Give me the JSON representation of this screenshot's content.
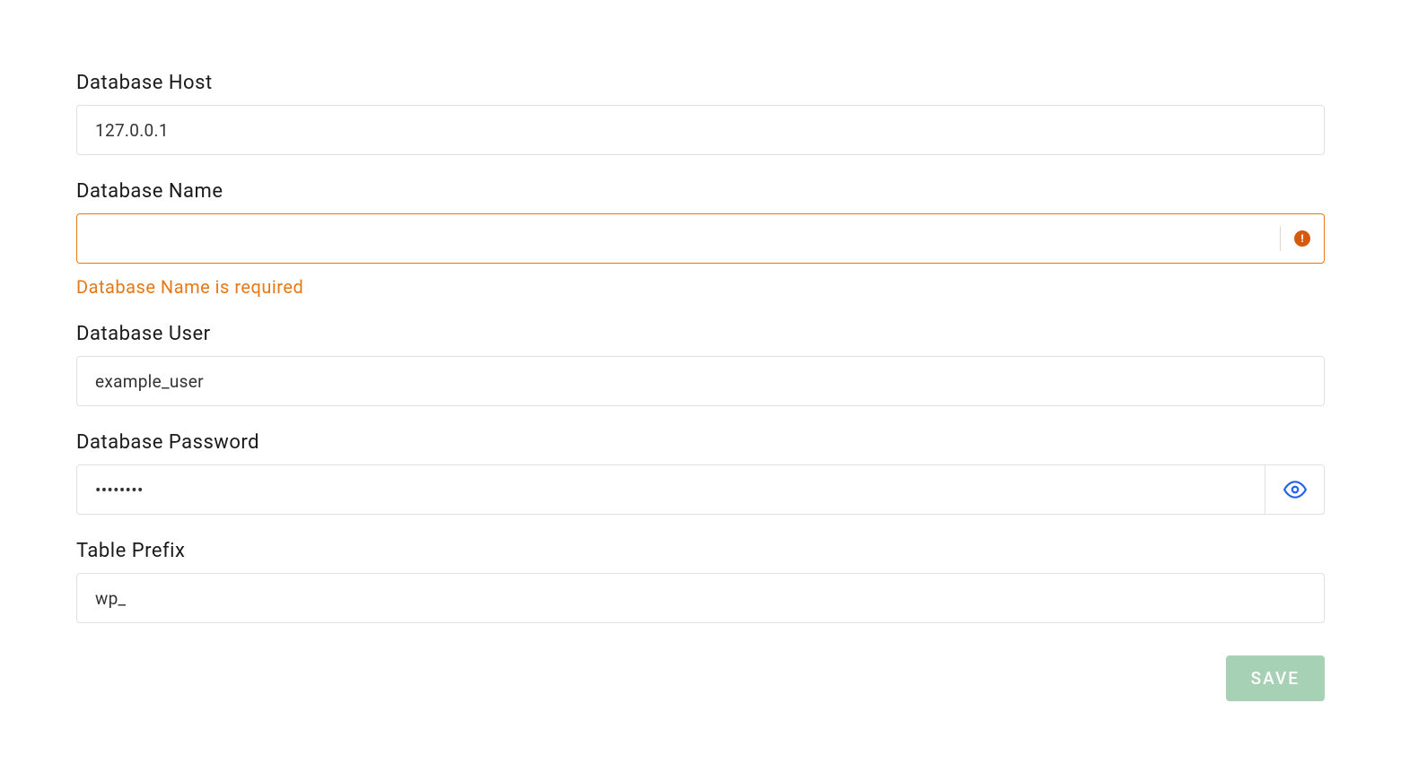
{
  "form": {
    "fields": {
      "host": {
        "label": "Database Host",
        "value": "127.0.0.1"
      },
      "name": {
        "label": "Database Name",
        "value": "",
        "error": "Database Name is required"
      },
      "user": {
        "label": "Database User",
        "value": "example_user"
      },
      "password": {
        "label": "Database Password",
        "value": "········"
      },
      "prefix": {
        "label": "Table Prefix",
        "value": "wp_"
      }
    },
    "buttons": {
      "save": "SAVE"
    }
  }
}
